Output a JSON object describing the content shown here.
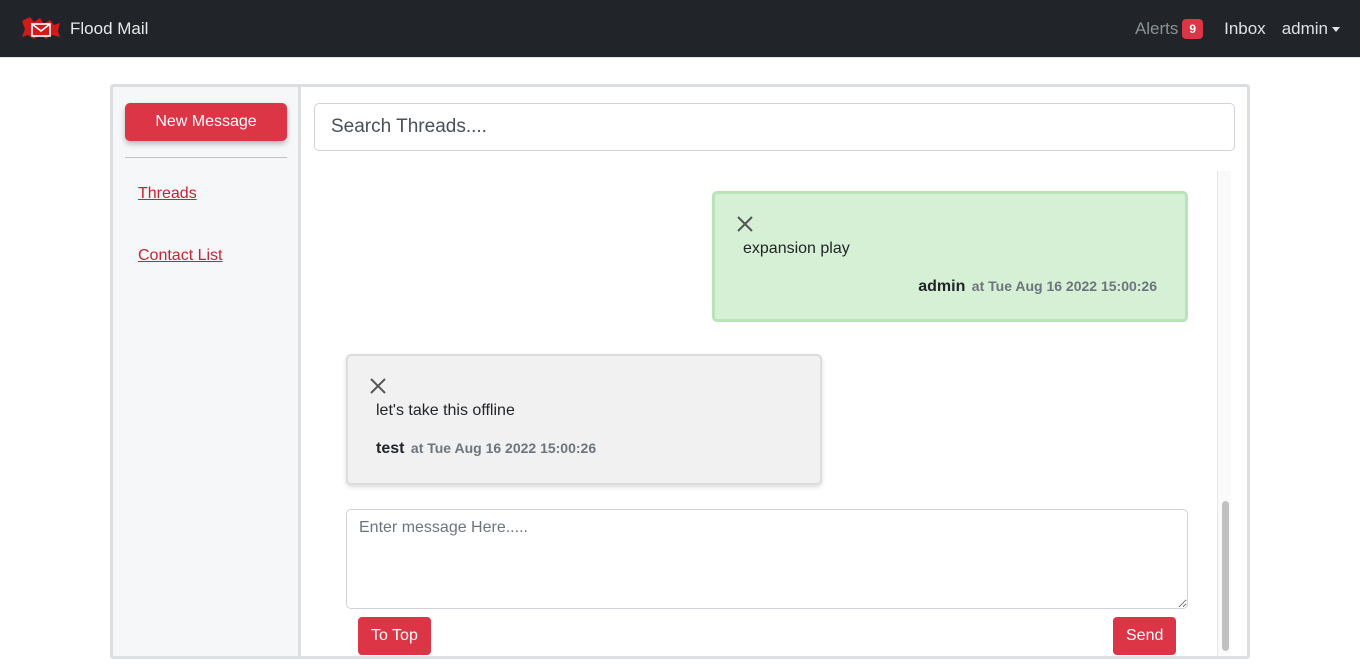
{
  "navbar": {
    "brand_name": "Flood Mail",
    "alerts_label": "Alerts",
    "alerts_count": "9",
    "inbox_label": "Inbox",
    "user_label": "admin"
  },
  "sidebar": {
    "new_message_label": "New Message",
    "links": [
      {
        "label": "Threads"
      },
      {
        "label": "Contact List"
      }
    ]
  },
  "search": {
    "placeholder": "Search Threads...."
  },
  "messages": [
    {
      "direction": "sent",
      "text": "expansion play",
      "author": "admin",
      "timestamp": "at Tue Aug 16 2022 15:00:26"
    },
    {
      "direction": "received",
      "text": "let's take this offline",
      "author": "test",
      "timestamp": "at Tue Aug 16 2022 15:00:26"
    }
  ],
  "composer": {
    "placeholder": "Enter message Here....."
  },
  "actions": {
    "to_top_label": "To Top",
    "send_label": "Send"
  },
  "colors": {
    "accent": "#dc3545",
    "navbar_bg": "#212529",
    "sent_bg": "#d6f0d5",
    "received_bg": "#f1f1f1"
  }
}
